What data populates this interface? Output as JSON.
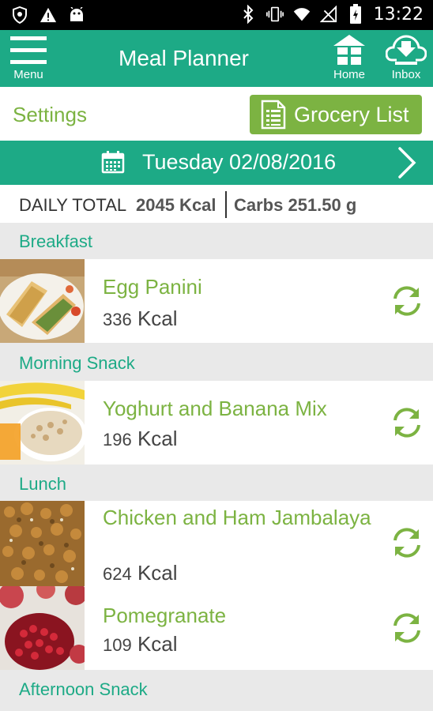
{
  "status_bar": {
    "left_icons": [
      "shield-icon",
      "warning-icon",
      "android-icon"
    ],
    "right_icons": [
      "bluetooth-icon",
      "vibrate-icon",
      "wifi-icon",
      "no-signal-icon",
      "battery-icon"
    ],
    "time": "13:22"
  },
  "header": {
    "title": "Meal Planner",
    "menu_label": "Menu",
    "home_label": "Home",
    "inbox_label": "Inbox",
    "color": "#1daa86"
  },
  "toolbar": {
    "settings_label": "Settings",
    "grocery_label": "Grocery List",
    "accent_color": "#7cb342"
  },
  "date": {
    "label": "Tuesday 02/08/2016"
  },
  "daily_total": {
    "label": "DAILY TOTAL",
    "kcal": "2045 Kcal",
    "carbs": "Carbs 251.50 g"
  },
  "sections": [
    {
      "name": "Breakfast",
      "meals": [
        {
          "name": "Egg Panini",
          "kcal_value": "336",
          "kcal_unit": "Kcal",
          "image": "egg-panini-photo"
        }
      ]
    },
    {
      "name": "Morning Snack",
      "meals": [
        {
          "name": "Yoghurt and Banana Mix",
          "kcal_value": "196",
          "kcal_unit": "Kcal",
          "image": "yoghurt-banana-photo"
        }
      ]
    },
    {
      "name": "Lunch",
      "meals": [
        {
          "name": "Chicken and Ham Jambalaya",
          "kcal_value": "624",
          "kcal_unit": "Kcal",
          "image": "jambalaya-photo"
        },
        {
          "name": "Pomegranate",
          "kcal_value": "109",
          "kcal_unit": "Kcal",
          "image": "pomegranate-photo"
        }
      ]
    },
    {
      "name": "Afternoon Snack",
      "meals": []
    }
  ]
}
